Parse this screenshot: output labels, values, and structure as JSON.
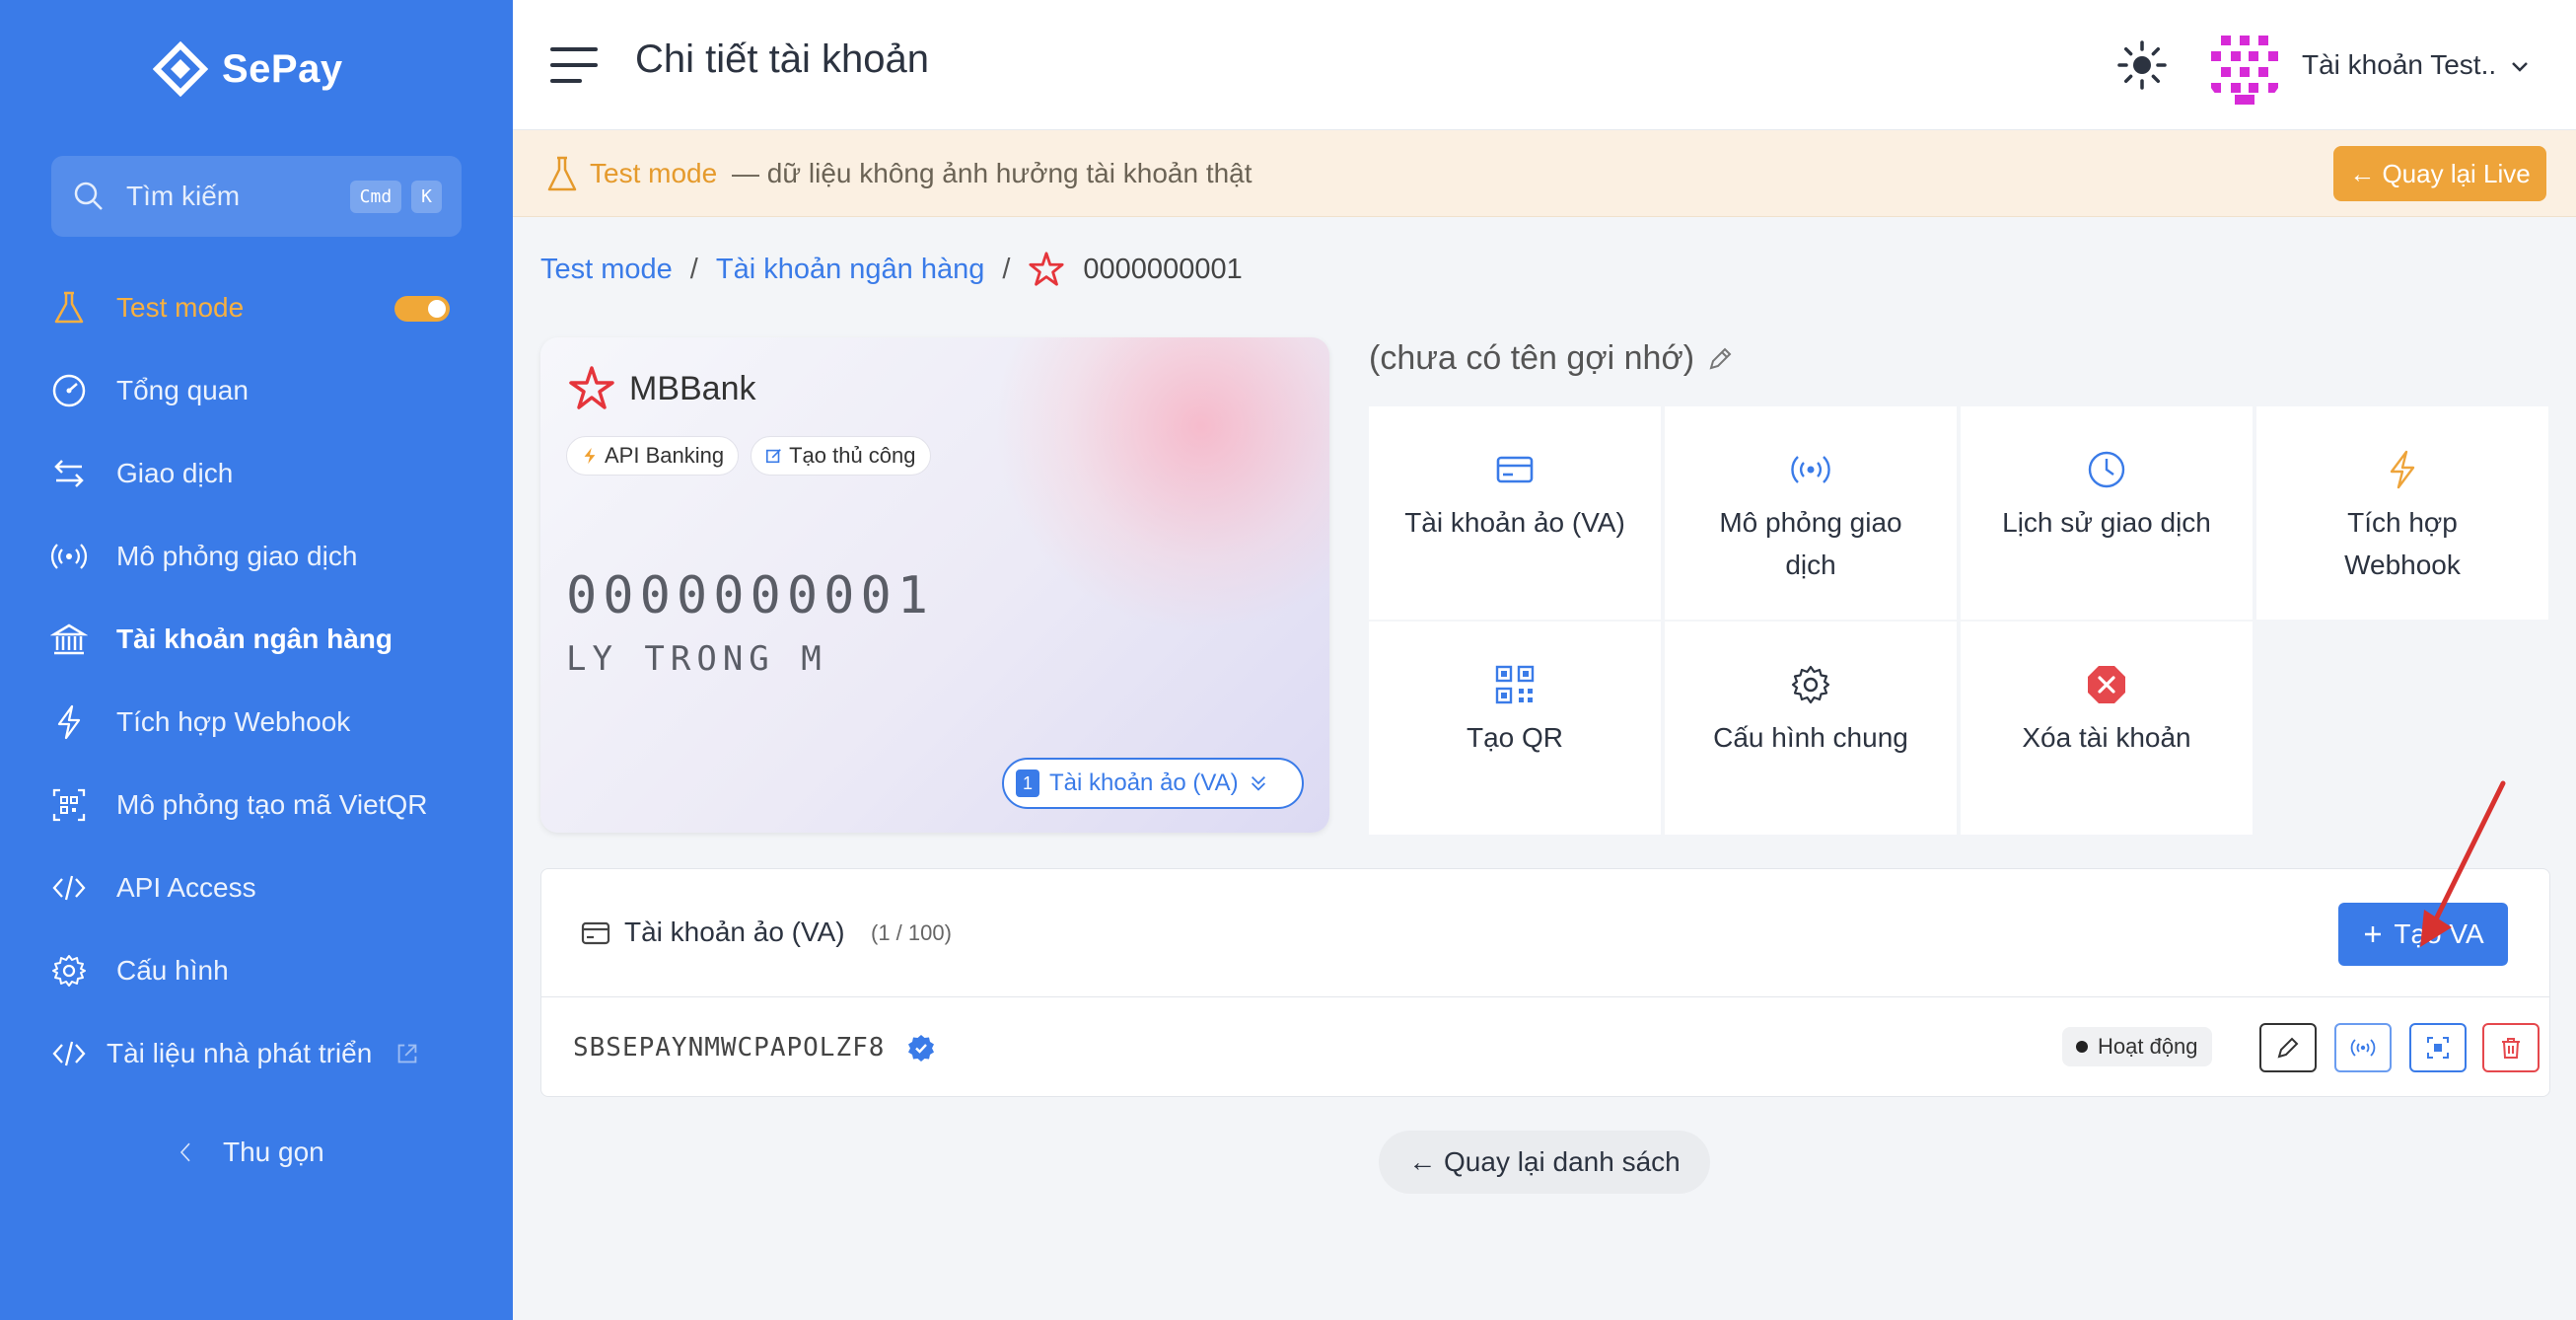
{
  "brand": {
    "name": "SePay"
  },
  "sidebar": {
    "search": {
      "placeholder": "Tìm kiếm",
      "shortcut_1": "Cmd",
      "shortcut_2": "K"
    },
    "items": [
      {
        "label": "Test mode",
        "icon": "flask-icon"
      },
      {
        "label": "Tổng quan",
        "icon": "dashboard-icon"
      },
      {
        "label": "Giao dịch",
        "icon": "transfer-icon"
      },
      {
        "label": "Mô phỏng giao dịch",
        "icon": "broadcast-icon"
      },
      {
        "label": "Tài khoản ngân hàng",
        "icon": "bank-icon"
      },
      {
        "label": "Tích hợp Webhook",
        "icon": "lightning-icon"
      },
      {
        "label": "Mô phỏng tạo mã VietQR",
        "icon": "qr-icon"
      },
      {
        "label": "API Access",
        "icon": "code-icon"
      },
      {
        "label": "Cấu hình",
        "icon": "gear-icon"
      },
      {
        "label": "Tài liệu nhà phát triển",
        "icon": "code-icon"
      }
    ],
    "collapse_label": "Thu gọn"
  },
  "header": {
    "title": "Chi tiết tài khoản",
    "account_name": "Tài khoản Test.."
  },
  "banner": {
    "title": "Test mode",
    "description": "— dữ liệu không ảnh hưởng tài khoản thật",
    "button": "← Quay lại Live"
  },
  "breadcrumb": {
    "item_1": "Test mode",
    "item_2": "Tài khoản ngân hàng",
    "current": "0000000001",
    "sep": "/"
  },
  "card": {
    "bank_name": "MBBank",
    "chip_1": "API Banking",
    "chip_2": "Tạo thủ công",
    "number": "0000000001",
    "holder": "LY TRONG M",
    "va_count": "1",
    "va_label": "Tài khoản ảo (VA)"
  },
  "nickname": "(chưa có tên gợi nhớ)",
  "actions": [
    {
      "label": "Tài khoản ảo (VA)",
      "icon": "card-icon"
    },
    {
      "label": "Mô phỏng giao dịch",
      "icon": "broadcast-icon"
    },
    {
      "label": "Lịch sử giao dịch",
      "icon": "clock-icon"
    },
    {
      "label": "Tích hợp Webhook",
      "icon": "lightning-icon"
    },
    {
      "label": "Tạo QR",
      "icon": "qr-icon"
    },
    {
      "label": "Cấu hình chung",
      "icon": "gear-icon"
    },
    {
      "label": "Xóa tài khoản",
      "icon": "delete-icon"
    }
  ],
  "va_section": {
    "title": "Tài khoản ảo (VA)",
    "limit": "(1 / 100)",
    "create_button": "Tạo VA",
    "rows": [
      {
        "code": "SBSEPAYNMWCPAPOLZF8",
        "status": "Hoạt động"
      }
    ]
  },
  "back_button": "← Quay lại danh sách",
  "colors": {
    "primary": "#3a7be8",
    "accent": "#eea43a",
    "danger": "#e5484d"
  }
}
